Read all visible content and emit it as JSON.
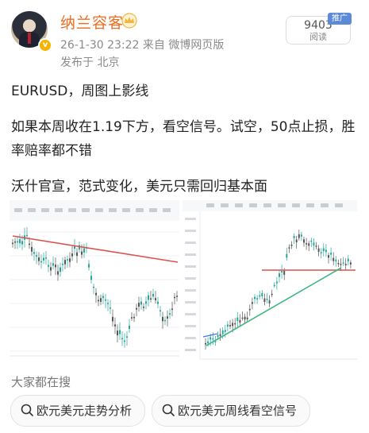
{
  "post": {
    "author": "纳兰容客",
    "date_source": "26-1-30 23:22  来自 微博网页版",
    "location": "发布于 北京",
    "read_count": "9403",
    "read_label": "阅读",
    "promo_label": "推广",
    "text_lines": [
      "EURUSD，周图上影线",
      "如果本周收在1.19下方，看空信号。试空，50点止损，胜率赔率都不错",
      "沃什官宣，范式变化，美元只需回归基本面"
    ]
  },
  "related": {
    "title": "大家都在搜",
    "items": [
      "欧元美元走势分析",
      "欧元美元周线看空信号"
    ]
  },
  "colors": {
    "author": "#f06b1e",
    "resistance_line": "#d9534f",
    "trend_line": "#3fb884",
    "candle_up": "#26a69a",
    "candle_down": "#555555"
  }
}
